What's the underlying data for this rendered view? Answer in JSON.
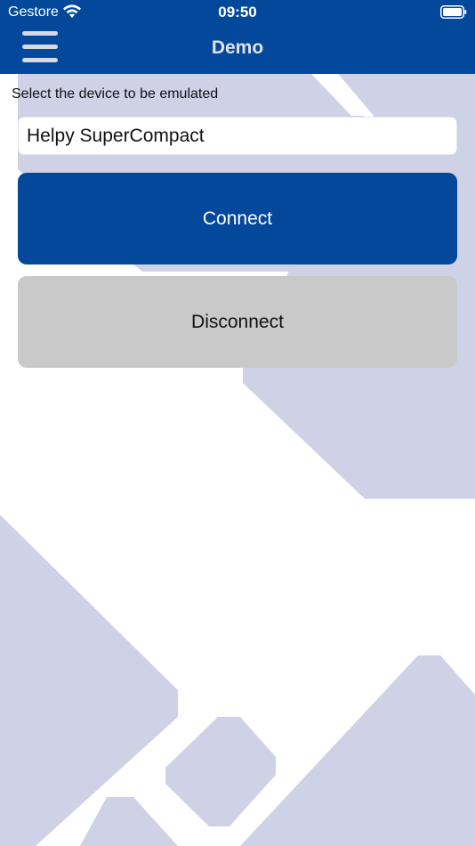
{
  "status_bar": {
    "carrier": "Gestore",
    "time": "09:50",
    "wifi_icon": "wifi-icon",
    "battery_icon": "battery-icon"
  },
  "nav": {
    "title": "Demo",
    "menu_icon": "hamburger-menu-icon"
  },
  "main": {
    "prompt": "Select the device to be emulated",
    "device_value": "Helpy SuperCompact",
    "connect_label": "Connect",
    "disconnect_label": "Disconnect"
  },
  "colors": {
    "primary": "#03489a",
    "secondary_button": "#c9c9c9",
    "background_shape": "#cfd2e6"
  }
}
